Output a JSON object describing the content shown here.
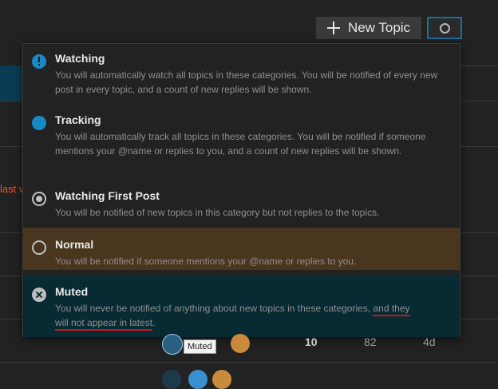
{
  "header": {
    "new_topic_label": "New Topic",
    "notification_icon": "circle-outline-icon"
  },
  "background": {
    "partial_text": "last v",
    "stats": [
      "10",
      "82",
      "4d"
    ]
  },
  "dropdown": {
    "options": [
      {
        "title": "Watching",
        "description": "You will automatically watch all topics in these categories. You will be notified of every new post in every topic, and a count of new replies will be shown.",
        "icon": "exclamation-circle-icon"
      },
      {
        "title": "Tracking",
        "description": "You will automatically track all topics in these categories. You will be notified if someone mentions your @name or replies to you, and a count of new replies will be shown.",
        "icon": "filled-circle-icon"
      },
      {
        "title": "Watching First Post",
        "description": "You will be notified of new topics in this category but not replies to the topics.",
        "icon": "dot-circle-icon"
      },
      {
        "title": "Normal",
        "description": "You will be notified if someone mentions your @name or replies to you.",
        "icon": "circle-outline-icon"
      },
      {
        "title": "Muted",
        "description_part1": "You will never be notified of anything about new topics in these categories, ",
        "description_part2": "and they",
        "description_part3": "will not appear in latest",
        "description_part4": ".",
        "icon": "times-circle-icon"
      }
    ]
  },
  "tooltip": {
    "text": "Muted"
  },
  "colors": {
    "accent_blue": "#1789c4",
    "normal_highlight": "#4a351e",
    "muted_highlight": "#072a33",
    "annotation_red": "#d0101a"
  }
}
